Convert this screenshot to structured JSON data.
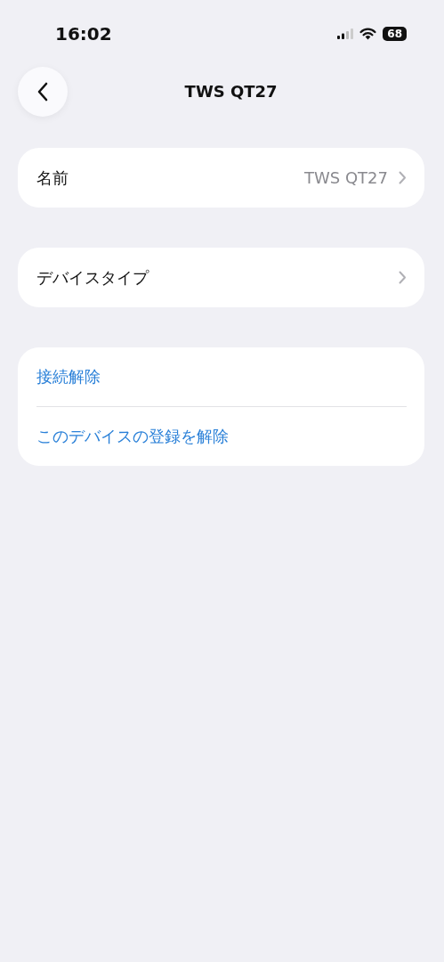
{
  "status_bar": {
    "time": "16:02",
    "battery": "68"
  },
  "nav": {
    "title": "TWS QT27"
  },
  "settings": [
    {
      "label": "名前",
      "value": "TWS QT27"
    },
    {
      "label": "デバイスタイプ"
    }
  ],
  "actions": [
    {
      "label": "接続解除"
    },
    {
      "label": "このデバイスの登録を解除"
    }
  ]
}
